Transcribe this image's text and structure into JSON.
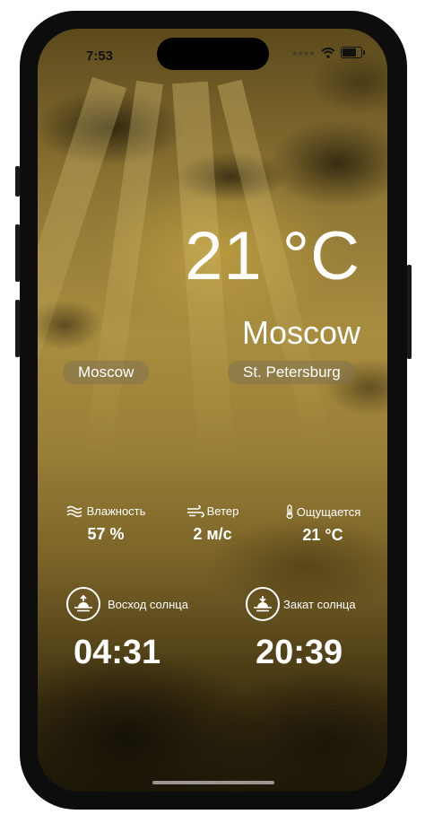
{
  "status_bar": {
    "time": "7:53",
    "battery_level": 0.85
  },
  "weather": {
    "temperature": "21 °C",
    "city": "Moscow"
  },
  "cities": [
    {
      "label": "Moscow"
    },
    {
      "label": "St. Petersburg"
    }
  ],
  "metrics": {
    "humidity": {
      "label": "Влажность",
      "value": "57 %",
      "icon": "wave-icon"
    },
    "wind": {
      "label": "Ветер",
      "value": "2 м/с",
      "icon": "wind-icon"
    },
    "feels_like": {
      "label": "Ощущается",
      "value": "21 °C",
      "icon": "thermometer-icon"
    }
  },
  "sun": {
    "sunrise": {
      "label": "Восход солнца",
      "time": "04:31",
      "icon": "sunrise-icon"
    },
    "sunset": {
      "label": "Закат солнца",
      "time": "20:39",
      "icon": "sunset-icon"
    }
  },
  "colors": {
    "text": "#ffffff",
    "chip_bg": "#82735080",
    "frame": "#0d0d0d"
  }
}
